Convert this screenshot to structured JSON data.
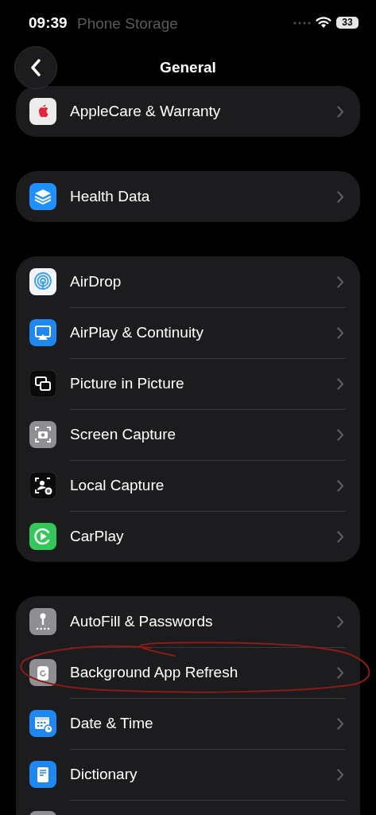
{
  "status_bar": {
    "time": "09:39",
    "battery": "33"
  },
  "scrolled_title": "Phone Storage",
  "nav": {
    "title": "General"
  },
  "groups": [
    {
      "items": [
        {
          "kind": "applecare",
          "label": "AppleCare & Warranty"
        }
      ]
    },
    {
      "items": [
        {
          "kind": "health",
          "label": "Health Data"
        }
      ]
    },
    {
      "items": [
        {
          "kind": "airdrop",
          "label": "AirDrop"
        },
        {
          "kind": "airplay",
          "label": "AirPlay & Continuity"
        },
        {
          "kind": "pip",
          "label": "Picture in Picture"
        },
        {
          "kind": "screencapture",
          "label": "Screen Capture"
        },
        {
          "kind": "localcapture",
          "label": "Local Capture"
        },
        {
          "kind": "carplay",
          "label": "CarPlay"
        }
      ]
    },
    {
      "items": [
        {
          "kind": "autofill",
          "label": "AutoFill & Passwords"
        },
        {
          "kind": "bgrefresh",
          "label": "Background App Refresh",
          "annotated": true
        },
        {
          "kind": "datetime",
          "label": "Date & Time"
        },
        {
          "kind": "dictionary",
          "label": "Dictionary"
        },
        {
          "kind": "partial"
        }
      ]
    }
  ]
}
